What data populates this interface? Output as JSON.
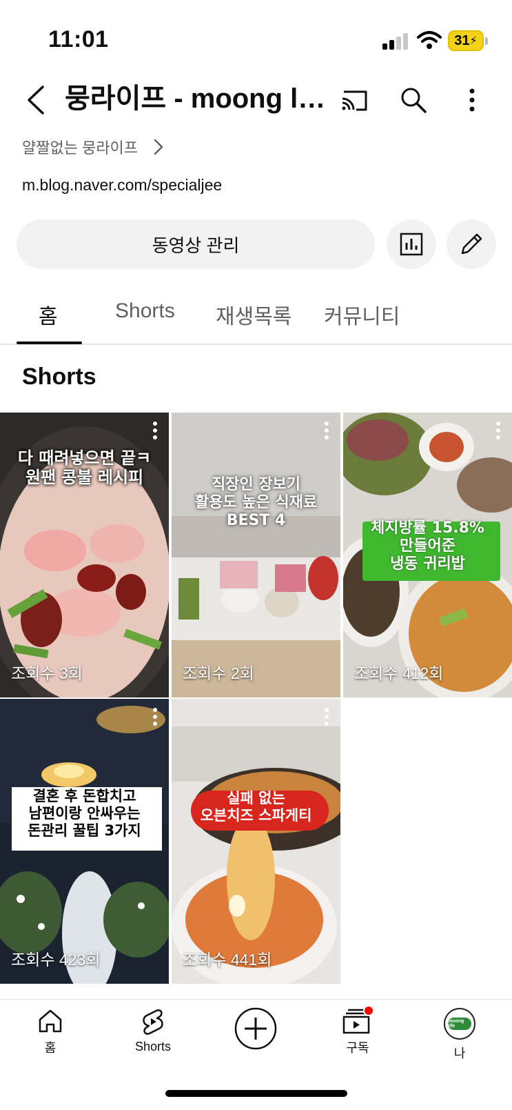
{
  "status_bar": {
    "time": "11:01",
    "battery": "31"
  },
  "header": {
    "title": "뭉라이프 - moong life",
    "description": "얄짤없는 뭉라이프",
    "link": "m.blog.naver.com/specialjee"
  },
  "actions": {
    "manage_label": "동영상 관리"
  },
  "tabs": [
    {
      "label": "홈"
    },
    {
      "label": "Shorts"
    },
    {
      "label": "재생목록"
    },
    {
      "label": "커뮤니티"
    }
  ],
  "section_title": "Shorts",
  "shorts": [
    {
      "overlay": [
        "다 때려넣으면 끝ㅋ",
        "원팬 콩불 레시피"
      ],
      "views": "조회수 3회"
    },
    {
      "overlay": [
        "직장인 장보기",
        "활용도 높은 식재료",
        "BEST 4"
      ],
      "views": "조회수 2회"
    },
    {
      "overlay": [
        "체지방률 15.8%",
        "만들어준",
        "냉동 귀리밥"
      ],
      "views": "조회수 412회"
    },
    {
      "overlay": [
        "결혼 후 돈합치고",
        "남편이랑 안싸우는",
        "돈관리 꿀팁 3가지"
      ],
      "views": "조회수 423회"
    },
    {
      "overlay": [
        "실패 없는",
        "오븐치즈 스파게티"
      ],
      "views": "조회수 441회"
    }
  ],
  "bottom_nav": {
    "items": [
      {
        "label": "홈",
        "icon": "home-icon"
      },
      {
        "label": "Shorts",
        "icon": "shorts-icon"
      },
      {
        "label": "",
        "icon": "create-icon"
      },
      {
        "label": "구독",
        "icon": "subscriptions-icon"
      },
      {
        "label": "나",
        "icon": "avatar",
        "avatar_text": "moong life"
      }
    ]
  },
  "colors": {
    "accent_red": "#ff0000",
    "battery_yellow": "#f4d21a"
  }
}
